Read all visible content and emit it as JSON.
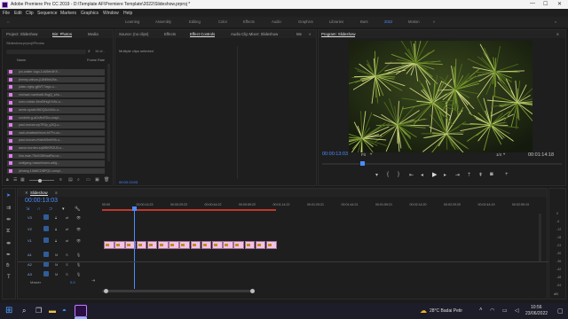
{
  "titlebar": {
    "title": "Adobe Premiere Pro CC 2019 - D:\\Template AF\\Premiere Template\\2022\\Slideshow.prproj *",
    "minimize": "—",
    "maximize": "☐",
    "close": "✕"
  },
  "menu": [
    "File",
    "Edit",
    "Clip",
    "Sequence",
    "Markers",
    "Graphics",
    "Window",
    "Help"
  ],
  "workspaces": [
    "Learning",
    "Assembly",
    "Editing",
    "Color",
    "Effects",
    "Audio",
    "Graphics",
    "Libraries",
    "Bars",
    "2022",
    "Motion"
  ],
  "active_workspace": "2022",
  "project_panel": {
    "tabs": [
      "Project: Slideshow",
      "Bin: Photos",
      "Media"
    ],
    "path": "Slideshow.prproj\\Photos",
    "count_text": "16 of...",
    "col_name": "Name",
    "col_rate": "Frame Rate",
    "items": [
      "jon-walter-lugo-1uU6eh4K9...",
      "jeremy-wilson-jL8Ni9dv2fw...",
      "julian-rigby-gjlWT7ctgo-u...",
      "michael-martinelli-9kgQ_sXs...",
      "sven-mieke-MmSfHq4Yk9c-u...",
      "annie-spratt-f0tDQ3oVk0c-u...",
      "nordelle-g-aDoNvRDo-unspl...",
      "paul-mocan-ep7R3p_y2IQ-u...",
      "nadi-whatisdelirium-bl7Fn-un...",
      "paul-mocan-eVaklhSmKHk-u...",
      "aaron-burden-sqDfBKRGLB-u...",
      "lina-mae-75sG0DKwaRw-un...",
      "wolfgang-hasselmann-adfg...",
      "jiehang-1l4k8CDBPQU-unspl..."
    ]
  },
  "source_panel": {
    "tabs": [
      "Source: (no clips)",
      "Effects",
      "Effect Controls",
      "Audio Clip Mixer: Slideshow",
      "Me"
    ],
    "active_tab": "Effect Controls",
    "message": "Multiple clips selected",
    "timecode": "00:00:13:03"
  },
  "program_panel": {
    "title": "Program: Slideshow",
    "timecode": "00:00:13:03",
    "fit": "Fit",
    "resolution": "1/4",
    "duration": "00:01:14:18"
  },
  "timeline": {
    "tab": "Slideshow",
    "timecode": "00:00:13:03",
    "ruler": [
      "00:00",
      "00:00:14:23",
      "00:00:29:23",
      "00:00:44:22",
      "00:00:59:22",
      "00:01:14:22",
      "00:01:29:21",
      "00:01:44:21",
      "00:01:59:21",
      "00:02:14:20",
      "00:02:29:20",
      "00:02:44:19",
      "00:02:59:19"
    ],
    "tracks": [
      "V3",
      "V2",
      "V1",
      "A1",
      "A2",
      "A3"
    ],
    "master_label": "Master",
    "master_value": "0.0",
    "clip_count": 16
  },
  "meter": {
    "scale": [
      "0",
      "-6",
      "-12",
      "-18",
      "-24",
      "-30",
      "-36",
      "-42",
      "-48",
      "-54"
    ],
    "unit": "dB"
  },
  "taskbar": {
    "weather": "28°C  Badai Petir",
    "time": "10:56",
    "date": "23/06/2022"
  },
  "colors": {
    "accent": "#4a8cff",
    "clip_fill": "#f2c3e7",
    "playhead": "#4a8cff",
    "workarea": "#c0372b",
    "chip": "#e27df0"
  }
}
